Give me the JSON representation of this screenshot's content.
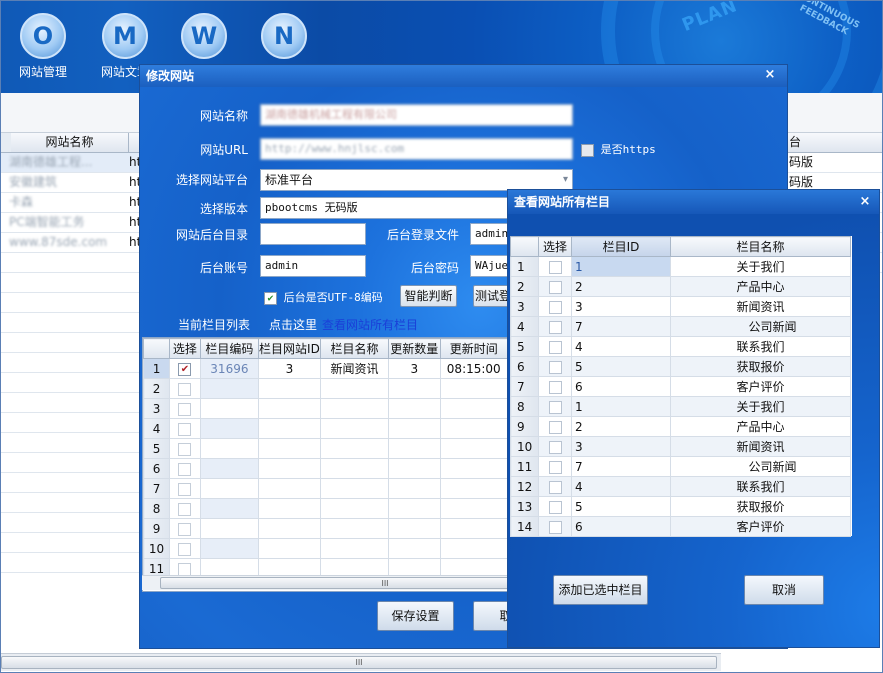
{
  "toolbar": {
    "buttons": [
      {
        "letter": "O",
        "label": "网站管理"
      },
      {
        "letter": "M",
        "label": "网站文章"
      },
      {
        "letter": "W",
        "label": ""
      },
      {
        "letter": "N",
        "label": ""
      }
    ],
    "banner_plan": "PLAN",
    "banner_feedback": "CONTINUOUS FEEDBACK"
  },
  "main_grid": {
    "header": "网站名称",
    "header_right": "台",
    "rows": [
      {
        "name": "湖南德雄工程...",
        "url": "ht",
        "right": "码版"
      },
      {
        "name": "安徽建筑",
        "url": "ht",
        "right": "码版"
      },
      {
        "name": "卡森",
        "url": "ht",
        "right": ""
      },
      {
        "name": "PC端智能工务",
        "url": "ht",
        "right": ""
      },
      {
        "name": "www.87sde.com",
        "url": "ht",
        "right": ""
      }
    ]
  },
  "edit_dialog": {
    "title": "修改网站",
    "close": "×",
    "fields": {
      "site_name_label": "网站名称",
      "site_name_value": "湖南德雄机械工程有限公司",
      "site_url_label": "网站URL",
      "site_url_value": "http://www.hnjlsc.com",
      "https_label": "是否https",
      "platform_label": "选择网站平台",
      "platform_value": "标准平台",
      "version_label": "选择版本",
      "version_value": "pbootcms 无码版",
      "admin_dir_label": "网站后台目录",
      "admin_dir_value": "",
      "login_file_label": "后台登录文件",
      "login_file_value": "admin.",
      "account_label": "后台账号",
      "account_value": "admin",
      "password_label": "后台密码",
      "password_value": "WAjuej",
      "utf8_label": "后台是否UTF-8编码",
      "smart_button": "智能判断",
      "test_button": "测试登",
      "current_list_label": "当前栏目列表",
      "click_here_label": "点击这里",
      "view_all_link": "查看网站所有栏目"
    },
    "grid": {
      "headers": [
        "选择",
        "栏目编码",
        "栏目网站ID",
        "栏目名称",
        "更新数量",
        "更新时间"
      ],
      "rows": [
        {
          "n": "1",
          "checked": true,
          "code": "31696",
          "site_id": "3",
          "name": "新闻资讯",
          "count": "3",
          "time": "08:15:00"
        },
        {
          "n": "2"
        },
        {
          "n": "3"
        },
        {
          "n": "4"
        },
        {
          "n": "5"
        },
        {
          "n": "6"
        },
        {
          "n": "7"
        },
        {
          "n": "8"
        },
        {
          "n": "9"
        },
        {
          "n": "10"
        },
        {
          "n": "11"
        }
      ]
    },
    "save_button": "保存设置",
    "cancel_button": "取消"
  },
  "columns_dialog": {
    "title": "查看网站所有栏目",
    "close": "×",
    "headers": [
      "选择",
      "栏目ID",
      "栏目名称"
    ],
    "rows": [
      {
        "n": "1",
        "id": "1",
        "name": "关于我们",
        "sub": false
      },
      {
        "n": "2",
        "id": "2",
        "name": "产品中心",
        "sub": false
      },
      {
        "n": "3",
        "id": "3",
        "name": "新闻资讯",
        "sub": false
      },
      {
        "n": "4",
        "id": "7",
        "name": "公司新闻",
        "sub": true
      },
      {
        "n": "5",
        "id": "4",
        "name": "联系我们",
        "sub": false
      },
      {
        "n": "6",
        "id": "5",
        "name": "获取报价",
        "sub": false
      },
      {
        "n": "7",
        "id": "6",
        "name": "客户评价",
        "sub": false
      },
      {
        "n": "8",
        "id": "1",
        "name": "关于我们",
        "sub": false
      },
      {
        "n": "9",
        "id": "2",
        "name": "产品中心",
        "sub": false
      },
      {
        "n": "10",
        "id": "3",
        "name": "新闻资讯",
        "sub": false
      },
      {
        "n": "11",
        "id": "7",
        "name": "公司新闻",
        "sub": true
      },
      {
        "n": "12",
        "id": "4",
        "name": "联系我们",
        "sub": false
      },
      {
        "n": "13",
        "id": "5",
        "name": "获取报价",
        "sub": false
      },
      {
        "n": "14",
        "id": "6",
        "name": "客户评价",
        "sub": false
      }
    ],
    "add_button": "添加已选中栏目",
    "cancel_button": "取消"
  },
  "scroll_glyph": "III"
}
